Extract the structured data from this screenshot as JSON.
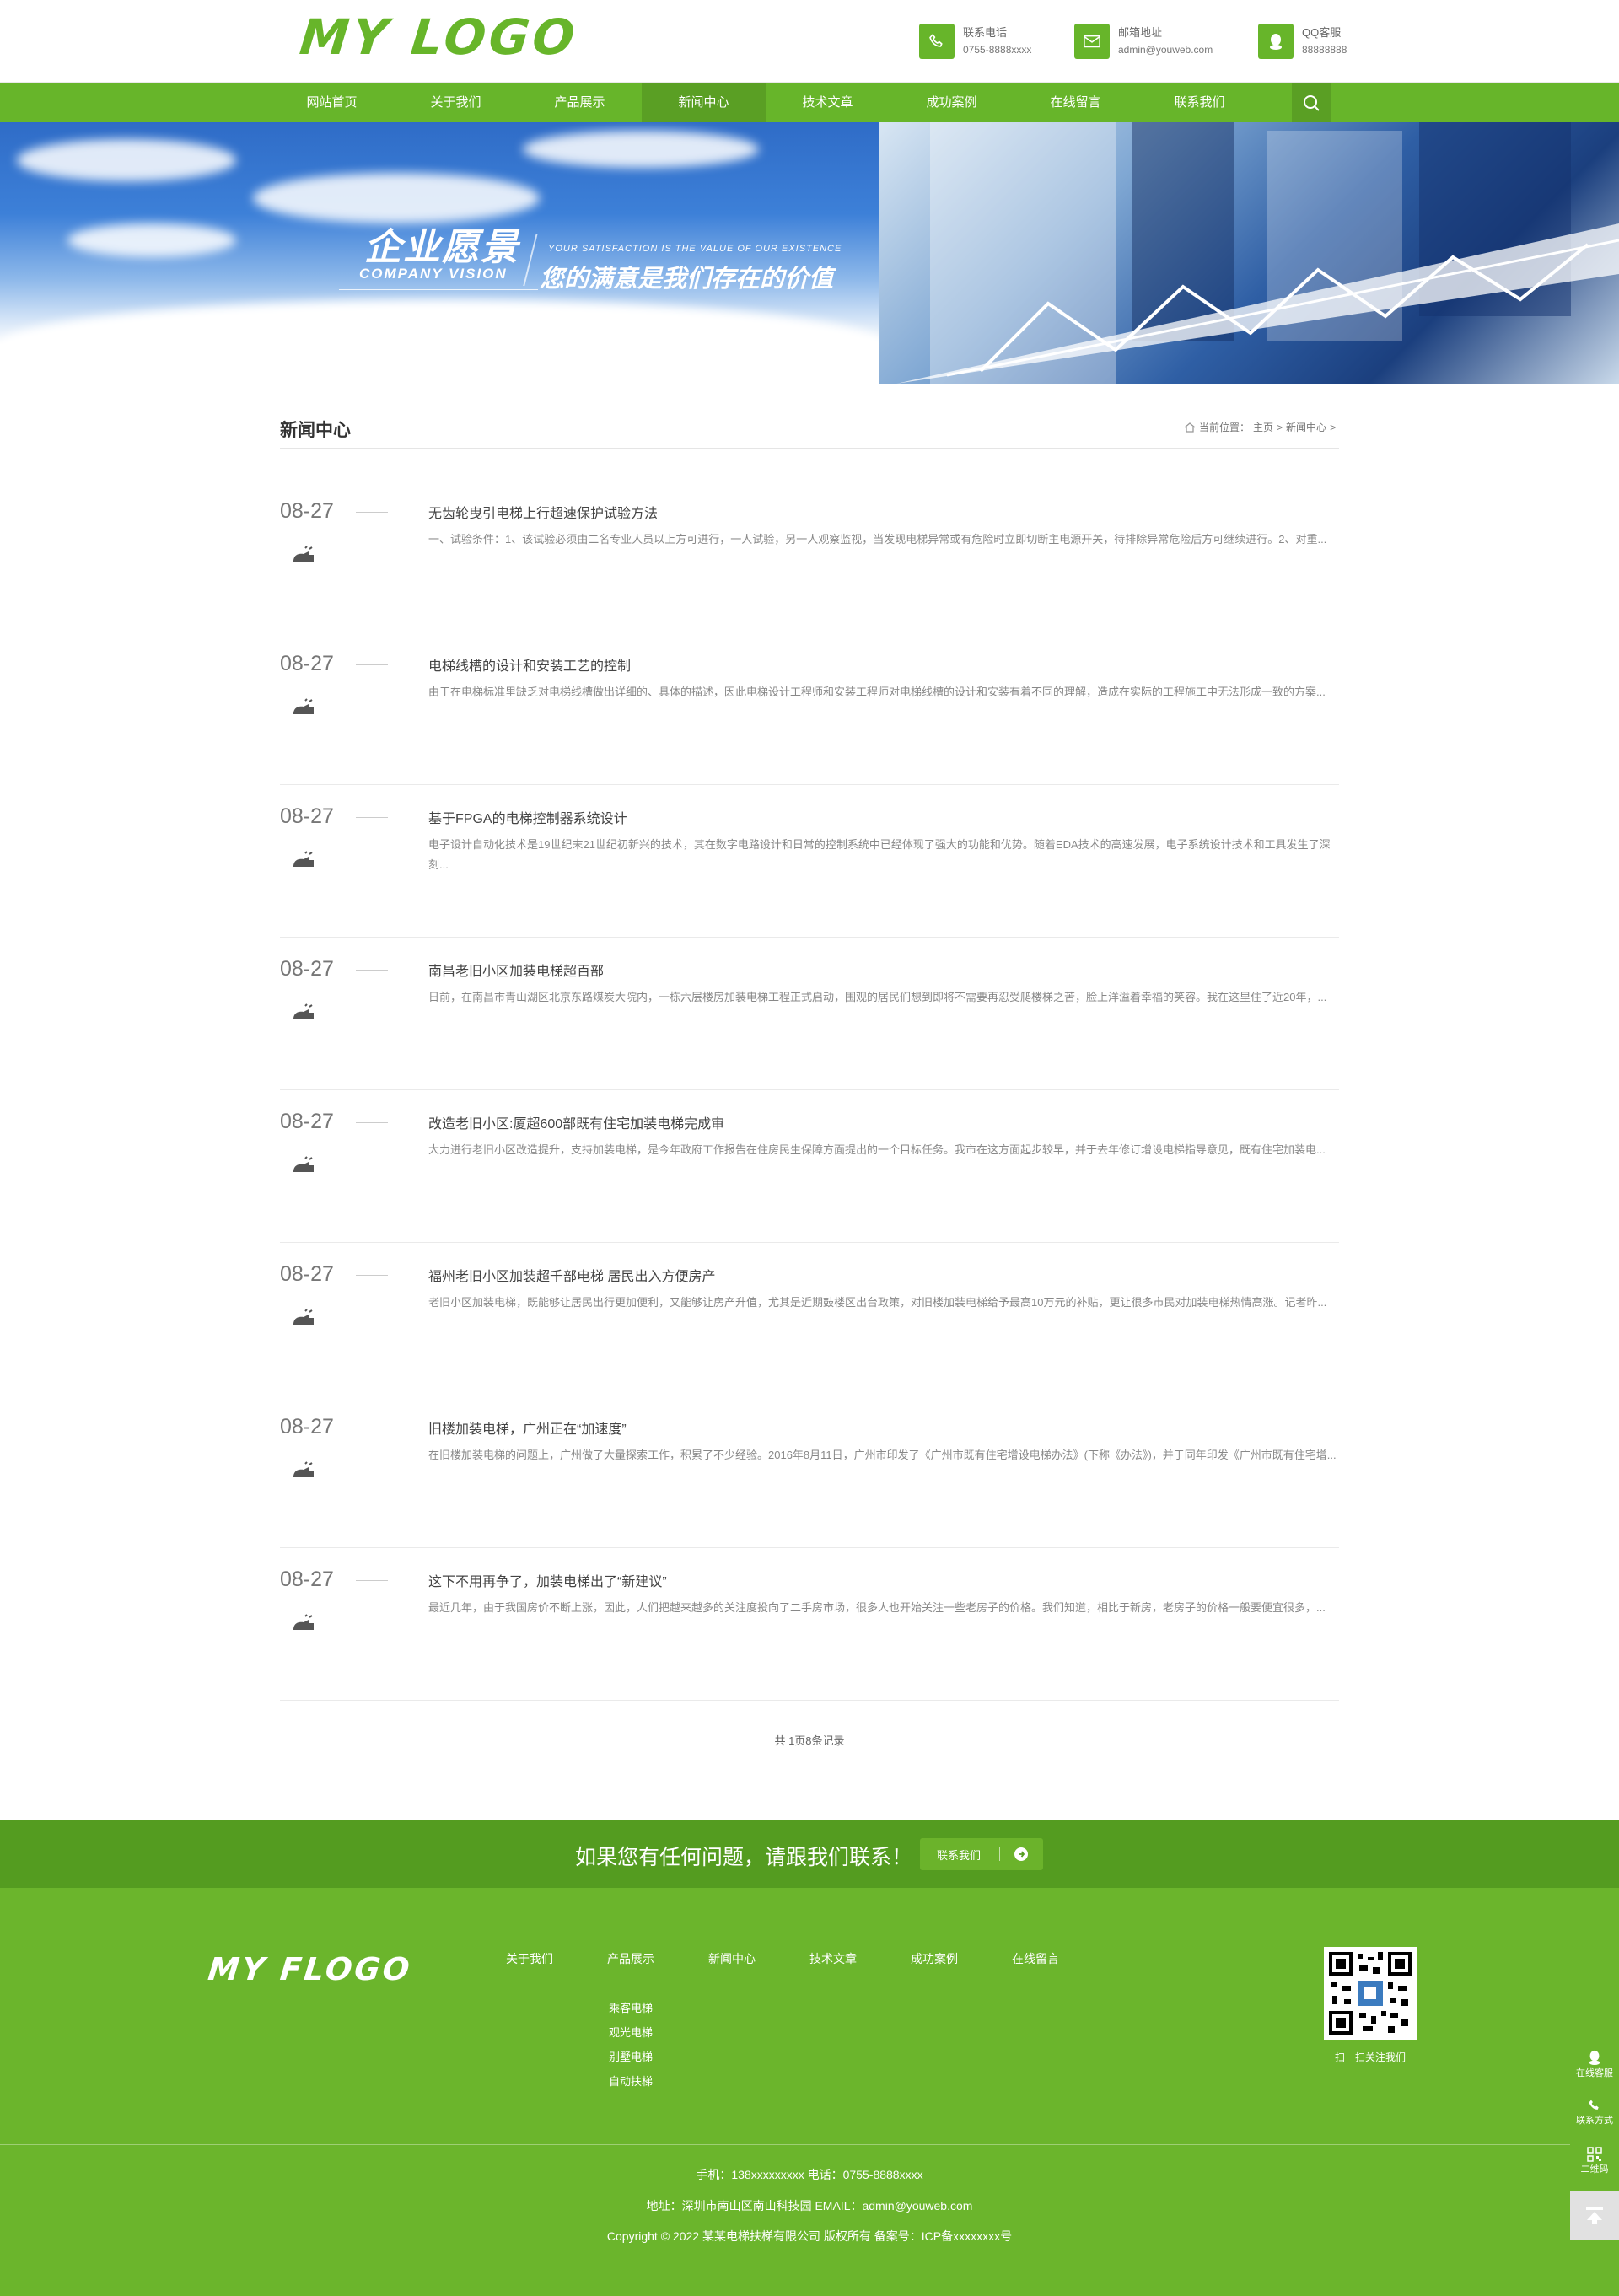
{
  "header": {
    "logo": "MY LOGO",
    "contacts": [
      {
        "icon": "phone-icon",
        "label": "联系电话",
        "value": "0755-8888xxxx"
      },
      {
        "icon": "mail-icon",
        "label": "邮箱地址",
        "value": "admin@youweb.com"
      },
      {
        "icon": "qq-icon",
        "label": "QQ客服",
        "value": "88888888"
      }
    ]
  },
  "nav": {
    "items": [
      "网站首页",
      "关于我们",
      "产品展示",
      "新闻中心",
      "技术文章",
      "成功案例",
      "在线留言",
      "联系我们"
    ],
    "active": "新闻中心",
    "search_icon": "search-icon"
  },
  "banner": {
    "title": "企业愿景",
    "subtitle_en": "COMPANY VISION",
    "small_en": "YOUR SATISFACTION IS THE VALUE OF OUR EXISTENCE",
    "slogan": "您的满意是我们存在的价值"
  },
  "section": {
    "title": "新闻中心",
    "breadcrumb": {
      "prefix": "当前位置：",
      "home": "主页",
      "sep": ">",
      "current": "新闻中心",
      "end": ">"
    }
  },
  "news": [
    {
      "date": "08-27",
      "title": "无齿轮曳引电梯上行超速保护试验方法",
      "desc": "一、试验条件：1、该试验必须由二名专业人员以上方可进行，一人试验，另一人观察监视，当发现电梯异常或有危险时立即切断主电源开关，待排除异常危险后方可继续进行。2、对重..."
    },
    {
      "date": "08-27",
      "title": "电梯线槽的设计和安装工艺的控制",
      "desc": "由于在电梯标准里缺乏对电梯线槽做出详细的、具体的描述，因此电梯设计工程师和安装工程师对电梯线槽的设计和安装有着不同的理解，造成在实际的工程施工中无法形成一致的方案..."
    },
    {
      "date": "08-27",
      "title": "基于FPGA的电梯控制器系统设计",
      "desc": "电子设计自动化技术是19世纪末21世纪初新兴的技术，其在数字电路设计和日常的控制系统中已经体现了强大的功能和优势。随着EDA技术的高速发展，电子系统设计技术和工具发生了深刻..."
    },
    {
      "date": "08-27",
      "title": "南昌老旧小区加装电梯超百部",
      "desc": "日前，在南昌市青山湖区北京东路煤炭大院内，一栋六层楼房加装电梯工程正式启动，围观的居民们想到即将不需要再忍受爬楼梯之苦，脸上洋溢着幸福的笑容。我在这里住了近20年，..."
    },
    {
      "date": "08-27",
      "title": "改造老旧小区:厦超600部既有住宅加装电梯完成审",
      "desc": "大力进行老旧小区改造提升，支持加装电梯，是今年政府工作报告在住房民生保障方面提出的一个目标任务。我市在这方面起步较早，并于去年修订增设电梯指导意见，既有住宅加装电..."
    },
    {
      "date": "08-27",
      "title": "福州老旧小区加装超千部电梯 居民出入方便房产",
      "desc": "老旧小区加装电梯，既能够让居民出行更加便利，又能够让房产升值，尤其是近期鼓楼区出台政策，对旧楼加装电梯给予最高10万元的补贴，更让很多市民对加装电梯热情高涨。记者昨..."
    },
    {
      "date": "08-27",
      "title": "旧楼加装电梯，广州正在“加速度”",
      "desc": "在旧楼加装电梯的问题上，广州做了大量探索工作，积累了不少经验。2016年8月11日，广州市印发了《广州市既有住宅增设电梯办法》(下称《办法》)，并于同年印发《广州市既有住宅增..."
    },
    {
      "date": "08-27",
      "title": "这下不用再争了，加装电梯出了“新建议”",
      "desc": "最近几年，由于我国房价不断上涨，因此，人们把越来越多的关注度投向了二手房市场，很多人也开始关注一些老房子的价格。我们知道，相比于新房，老房子的价格一般要便宜很多，..."
    }
  ],
  "pager": {
    "text": "共 1页8条记录"
  },
  "cta": {
    "text": "如果您有任何问题，请跟我们联系！",
    "button": "联系我们"
  },
  "footer": {
    "logo": "MY FLOGO",
    "columns": [
      {
        "title": "关于我们",
        "items": []
      },
      {
        "title": "产品展示",
        "items": [
          "乘客电梯",
          "观光电梯",
          "别墅电梯",
          "自动扶梯"
        ]
      },
      {
        "title": "新闻中心",
        "items": []
      },
      {
        "title": "技术文章",
        "items": []
      },
      {
        "title": "成功案例",
        "items": []
      },
      {
        "title": "在线留言",
        "items": []
      }
    ],
    "qr_label": "扫一扫关注我们",
    "line1": "手机：138xxxxxxxxx   电话：0755-8888xxxx",
    "line2": "地址：深圳市南山区南山科技园   EMAIL：admin@youweb.com",
    "line3": "Copyright © 2022 某某电梯扶梯有限公司 版权所有  备案号：ICP备xxxxxxxx号"
  },
  "side": {
    "items": [
      {
        "icon": "qq-icon",
        "label": "在线客服"
      },
      {
        "icon": "phone-icon",
        "label": "联系方式"
      },
      {
        "icon": "qrcode-icon",
        "label": "二维码"
      }
    ],
    "top_icon": "back-to-top-icon"
  },
  "colors": {
    "brand": "#67b52a",
    "brand_dark": "#549c20",
    "footer": "#6bb52c"
  }
}
